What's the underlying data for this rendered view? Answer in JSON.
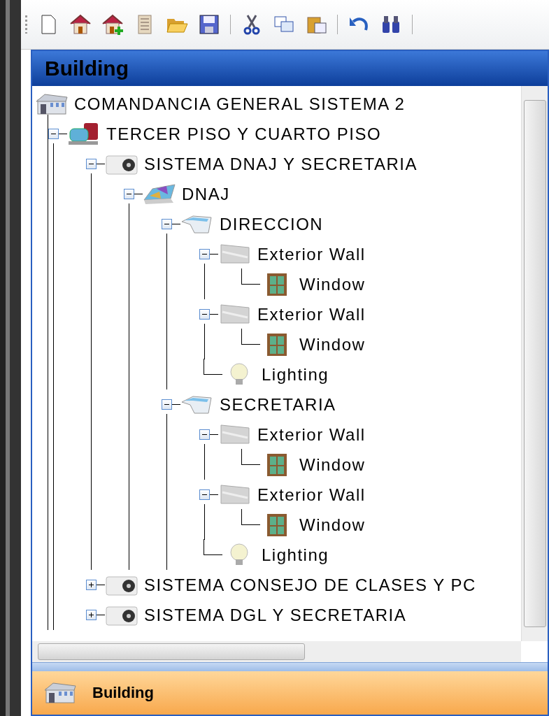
{
  "panel": {
    "title": "Building"
  },
  "tree": [
    {
      "label": "COMANDANCIA GENERAL SISTEMA 2",
      "kind": "building",
      "children": [
        {
          "label": "TERCER PISO Y CUARTO PISO",
          "kind": "machine",
          "expanded": true,
          "children": [
            {
              "label": "SISTEMA DNAJ Y SECRETARIA",
              "kind": "ac",
              "expanded": true,
              "children": [
                {
                  "label": "DNAJ",
                  "kind": "panel",
                  "expanded": true,
                  "children": [
                    {
                      "label": "DIRECCION",
                      "kind": "tray",
                      "expanded": true,
                      "children": [
                        {
                          "label": "Exterior Wall",
                          "kind": "wall",
                          "expanded": true,
                          "children": [
                            {
                              "label": "Window",
                              "kind": "window"
                            }
                          ]
                        },
                        {
                          "label": "Exterior Wall",
                          "kind": "wall",
                          "expanded": true,
                          "children": [
                            {
                              "label": "Window",
                              "kind": "window"
                            }
                          ]
                        },
                        {
                          "label": "Lighting",
                          "kind": "bulb"
                        }
                      ]
                    },
                    {
                      "label": "SECRETARIA",
                      "kind": "tray",
                      "expanded": true,
                      "children": [
                        {
                          "label": "Exterior Wall",
                          "kind": "wall",
                          "expanded": true,
                          "children": [
                            {
                              "label": "Window",
                              "kind": "window"
                            }
                          ]
                        },
                        {
                          "label": "Exterior Wall",
                          "kind": "wall",
                          "expanded": true,
                          "children": [
                            {
                              "label": "Window",
                              "kind": "window"
                            }
                          ]
                        },
                        {
                          "label": "Lighting",
                          "kind": "bulb"
                        }
                      ]
                    }
                  ]
                }
              ]
            },
            {
              "label": "SISTEMA CONSEJO DE  CLASES Y PC",
              "kind": "ac",
              "expanded": false
            },
            {
              "label": "SISTEMA DGL Y SECRETARIA",
              "kind": "ac",
              "expanded": false
            }
          ]
        }
      ]
    }
  ],
  "footer": {
    "label": "Building"
  }
}
